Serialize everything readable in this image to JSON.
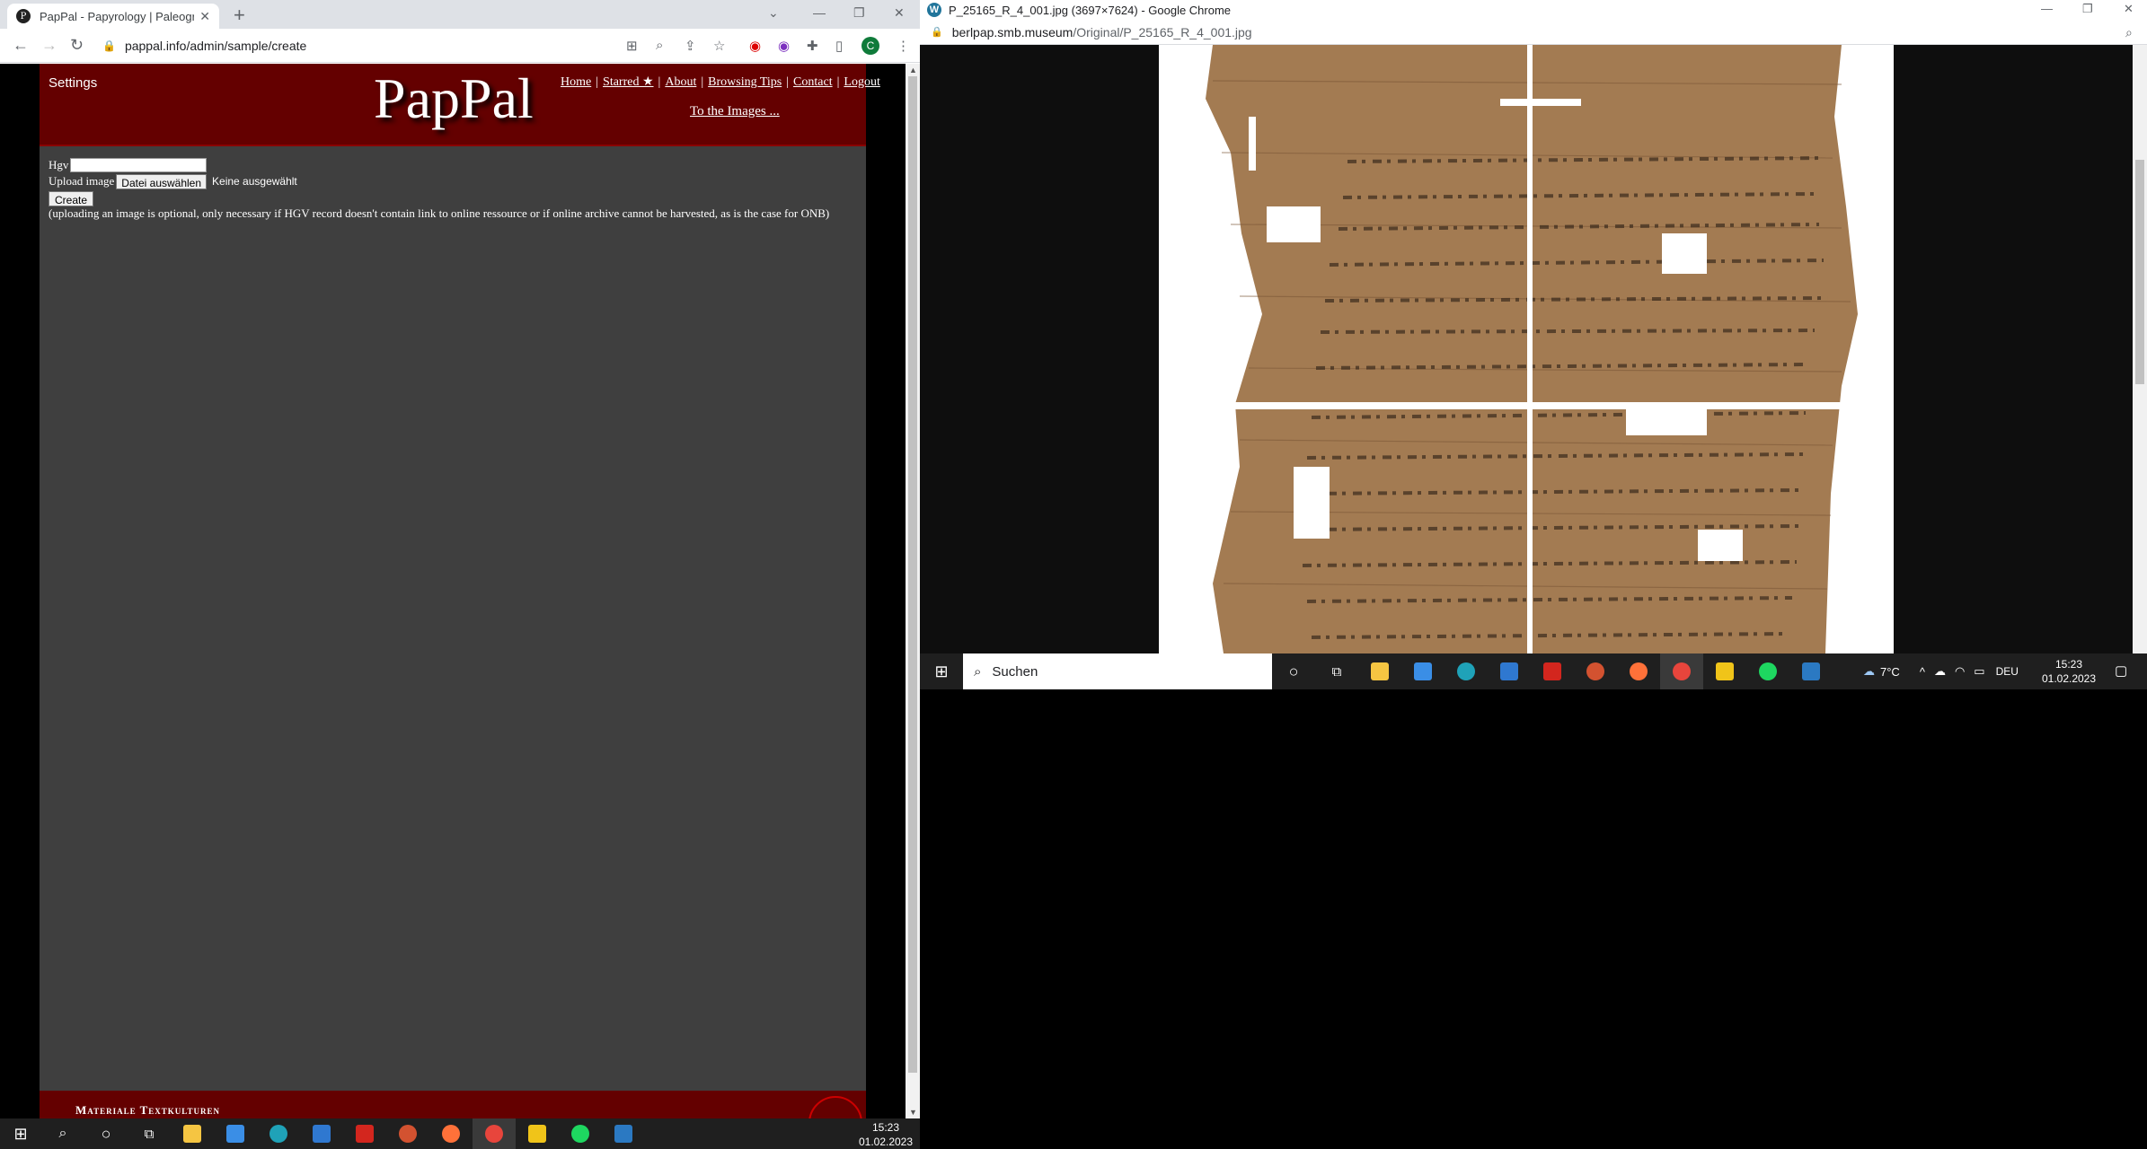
{
  "left_window": {
    "tab": {
      "favicon": "P",
      "title": "PapPal - Papyrology | Paleograph"
    },
    "url": "pappal.info/admin/sample/create",
    "avatar_letter": "C",
    "site": {
      "settings_label": "Settings",
      "logo": "PapPal",
      "nav": [
        "Home",
        "Starred ★",
        "About",
        "Browsing Tips",
        "Contact",
        "Logout"
      ],
      "to_images": "To the Images ...",
      "form": {
        "hgv_label": "Hgv",
        "upload_label": "Upload image",
        "choose_file_button": "Datei auswählen",
        "no_file_text": "Keine ausgewählt",
        "create_button": "Create",
        "note": "(uploading an image is optional, only necessary if HGV record doesn't contain link to online ressource or if online archive cannot be harvested, as is the case for ONB)"
      },
      "footer_text": "Materiale Textkulturen"
    }
  },
  "right_window": {
    "title": "P_25165_R_4_001.jpg (3697×7624) - Google Chrome",
    "url_host": "berlpap.smb.museum",
    "url_path": "/Original/P_25165_R_4_001.jpg"
  },
  "taskbar_left": {
    "time": "15:23",
    "date": "01.02.2023"
  },
  "taskbar_right": {
    "search_placeholder": "Suchen",
    "weather": "7°C",
    "lang": "DEU",
    "time": "15:23",
    "date": "01.02.2023"
  },
  "colors": {
    "site_bg": "#3f3f3f",
    "header_red": "#640000",
    "papyrus": "#a07850"
  }
}
